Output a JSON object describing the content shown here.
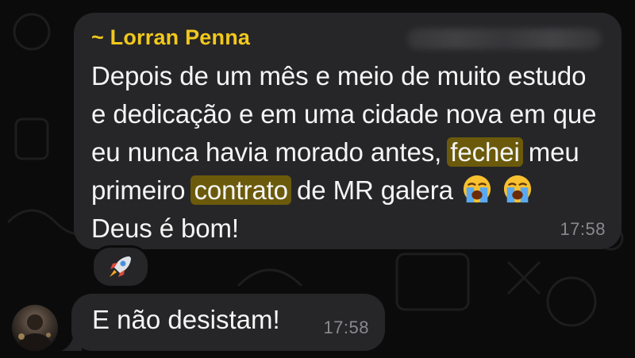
{
  "message1": {
    "sender": "~ Lorran Penna",
    "text_parts": {
      "p1": "Depois de um mês e meio de muito estudo e dedicação e em uma cidade nova em que eu nunca havia morado antes, ",
      "highlight1": "fechei",
      "p2": " meu primeiro ",
      "highlight2": "contrato",
      "p3": " de MR galera ",
      "p4": " Deus é bom!"
    },
    "emojis": [
      "loudly-crying-face-icon",
      "loudly-crying-face-icon"
    ],
    "time": "17:58",
    "reaction": "rocket-icon"
  },
  "message2": {
    "text": "E não desistam!",
    "time": "17:58"
  },
  "colors": {
    "background": "#0b0b0c",
    "bubble": "#262628",
    "sender": "#f2c81c",
    "highlight": "#6b5a0b",
    "timestamp": "#8a8a8e"
  }
}
